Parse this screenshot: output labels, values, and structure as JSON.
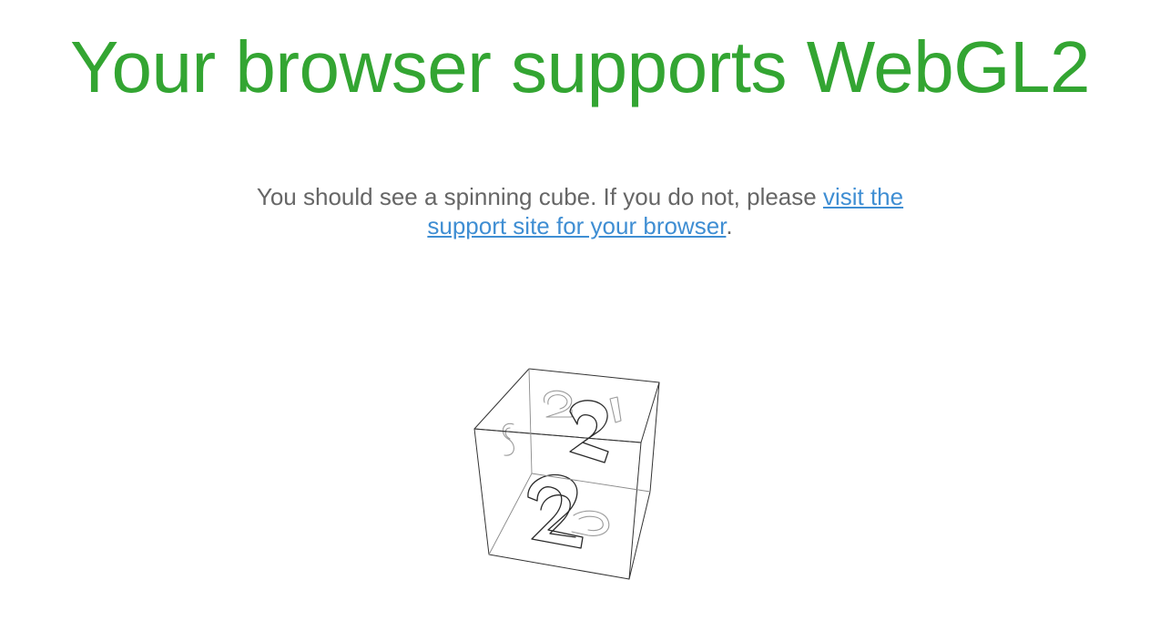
{
  "page": {
    "headline": "Your browser supports WebGL2",
    "message_text": "You should see a spinning cube. If you do not, please ",
    "support_link_label": "visit the support site for your browser",
    "message_end": ".",
    "headline_color": "#33a532",
    "link_color": "#3f8ed3",
    "text_color": "#666666"
  },
  "cube": {
    "face_glyph": "2"
  }
}
